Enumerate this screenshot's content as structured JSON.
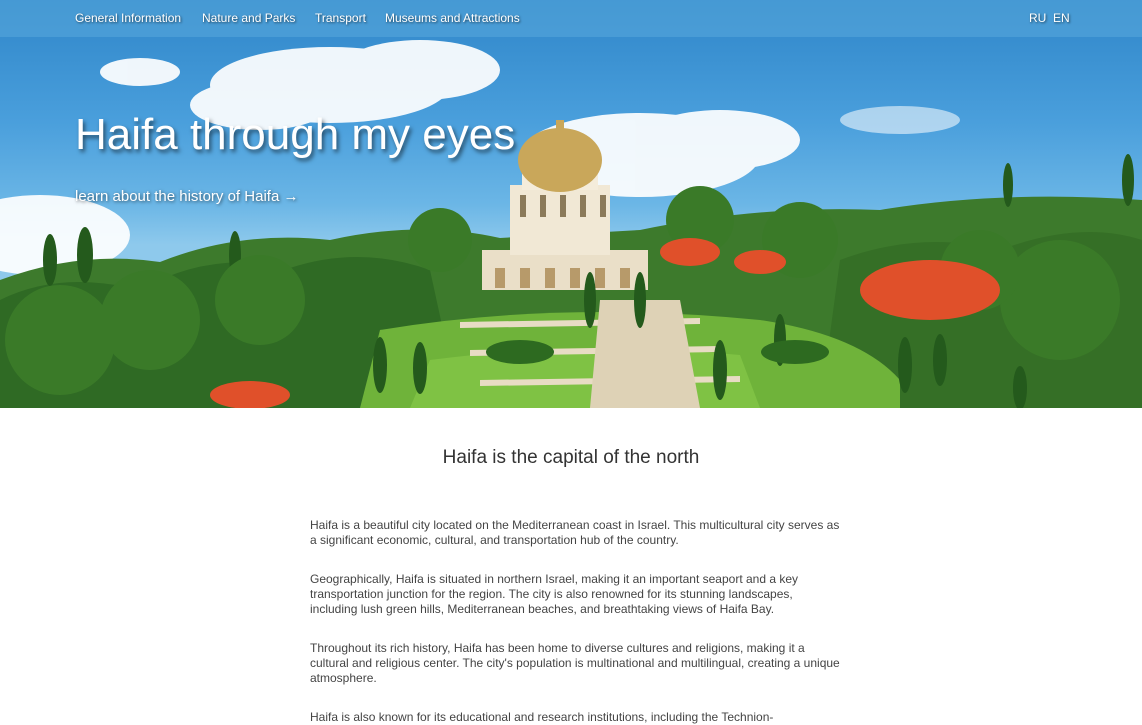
{
  "nav": {
    "items": [
      {
        "label": "General Information"
      },
      {
        "label": "Nature and Parks"
      },
      {
        "label": "Transport"
      },
      {
        "label": "Museums and Attractions"
      }
    ],
    "languages": [
      "RU",
      "EN"
    ]
  },
  "hero": {
    "title": "Haifa through my eyes",
    "link_text": "learn about the history of Haifa →"
  },
  "main": {
    "heading": "Haifa is the capital of the north",
    "paragraphs": [
      "Haifa is a beautiful city located on the Mediterranean coast in Israel. This multicultural city serves as a significant economic, cultural, and transportation hub of the country.",
      "Geographically, Haifa is situated in northern Israel, making it an important seaport and a key transportation junction for the region. The city is also renowned for its stunning landscapes, including lush green hills, Mediterranean beaches, and breathtaking views of Haifa Bay.",
      "Throughout its rich history, Haifa has been home to diverse cultures and religions, making it a cultural and religious center. The city's population is multinational and multilingual, creating a unique atmosphere.",
      "Haifa is also known for its educational and research institutions, including the Technion-"
    ]
  },
  "colors": {
    "sky": "#4a9fdc",
    "foliage": "#3f7d2a",
    "lawn": "#6fb33a",
    "flowers": "#e0502a",
    "stone": "#e8dcc4",
    "dome": "#c9a75a"
  }
}
